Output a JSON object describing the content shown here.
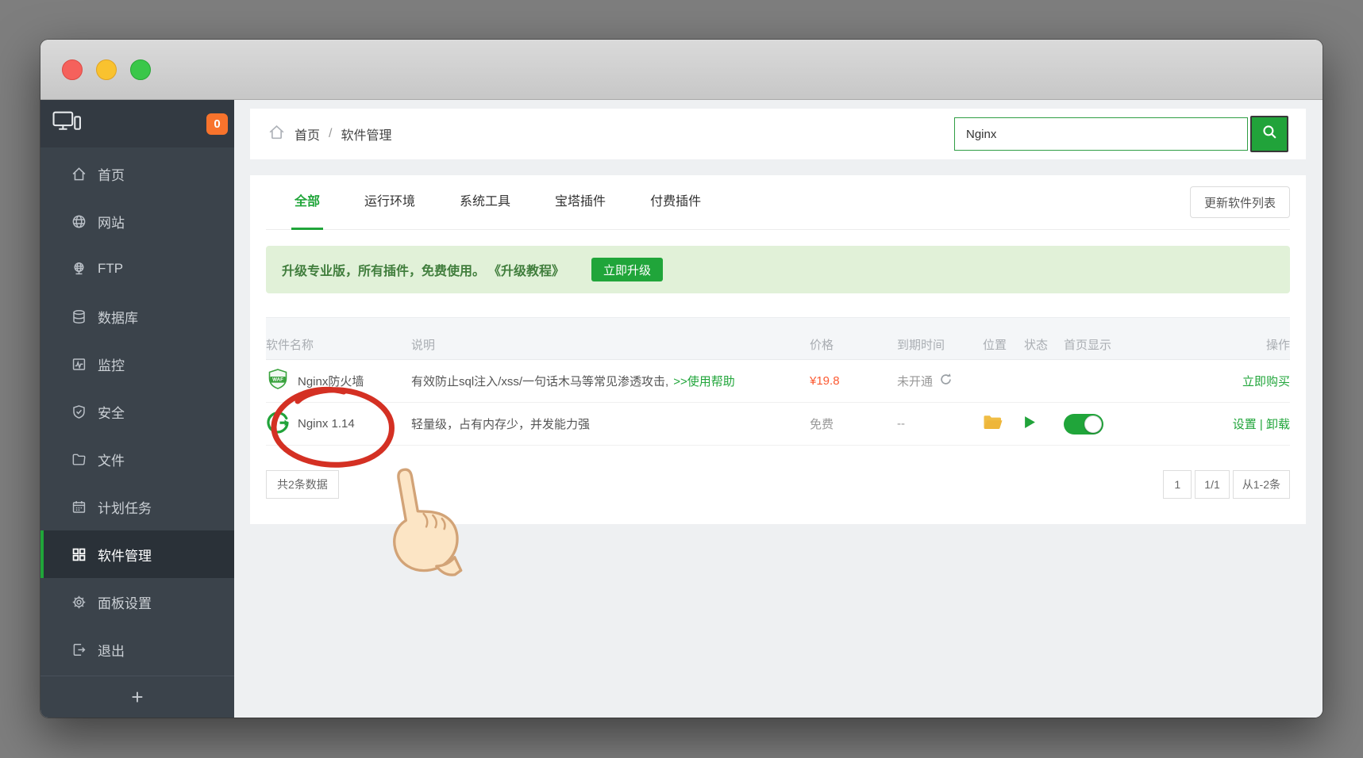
{
  "window": {
    "badge_count": "0"
  },
  "sidebar": {
    "items": [
      {
        "label": "首页"
      },
      {
        "label": "网站"
      },
      {
        "label": "FTP"
      },
      {
        "label": "数据库"
      },
      {
        "label": "监控"
      },
      {
        "label": "安全"
      },
      {
        "label": "文件"
      },
      {
        "label": "计划任务"
      },
      {
        "label": "软件管理",
        "active": true
      },
      {
        "label": "面板设置"
      },
      {
        "label": "退出"
      }
    ],
    "add_label": "+"
  },
  "breadcrumb": {
    "home": "首页",
    "separator": "/",
    "current": "软件管理"
  },
  "search": {
    "value": "Nginx"
  },
  "tabs": [
    {
      "label": "全部",
      "active": true
    },
    {
      "label": "运行环境"
    },
    {
      "label": "系统工具"
    },
    {
      "label": "宝塔插件"
    },
    {
      "label": "付费插件"
    }
  ],
  "toolbar": {
    "update_button": "更新软件列表"
  },
  "banner": {
    "text": "升级专业版，所有插件，免费使用。",
    "tutorial_link": "《升级教程》",
    "upgrade_button": "立即升级"
  },
  "table": {
    "headers": [
      "软件名称",
      "说明",
      "价格",
      "到期时间",
      "位置",
      "状态",
      "首页显示",
      "操作"
    ],
    "rows": [
      {
        "name": "Nginx防火墙",
        "description": "有效防止sql注入/xss/一句话木马等常见渗透攻击,",
        "help_link": ">>使用帮助",
        "price": "¥19.8",
        "expire": "未开通",
        "action": "立即购买"
      },
      {
        "name": "Nginx 1.14",
        "description": "轻量级，占有内存少，并发能力强",
        "price": "免费",
        "expire": "--",
        "action_settings": "设置",
        "action_divider": "|",
        "action_uninstall": "卸载"
      }
    ]
  },
  "pagination": {
    "total": "共2条数据",
    "page": "1",
    "page_indicator": "1/1",
    "range": "从1-2条"
  },
  "colors": {
    "accent_green": "#20a53a",
    "badge_orange": "#f8732c",
    "price_orange": "#fc5a32",
    "banner_bg": "#e1f1d8",
    "banner_text": "#417e3d",
    "sidebar_bg": "#3b434b",
    "annotation_red": "#d43023"
  }
}
